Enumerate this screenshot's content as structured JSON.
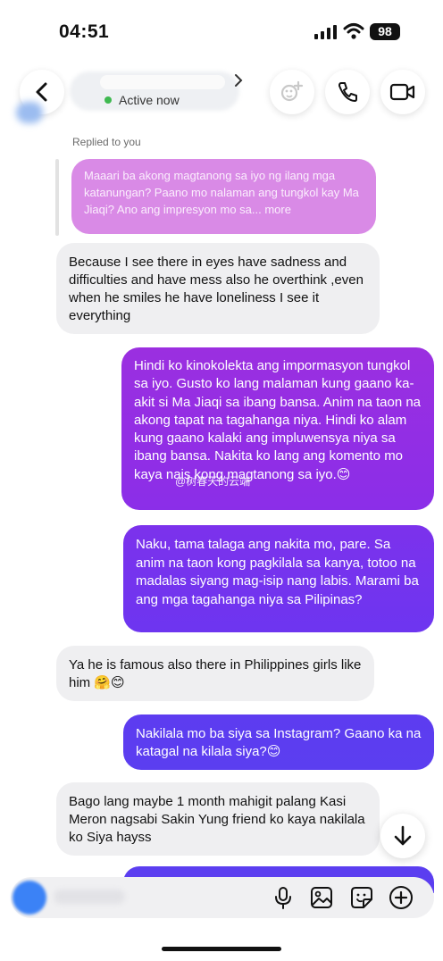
{
  "status_bar": {
    "time": "04:51",
    "battery": "98"
  },
  "header": {
    "active_status": "Active now",
    "icons": [
      "back-arrow-icon",
      "chevron-right-icon",
      "effects-icon",
      "phone-icon",
      "video-camera-icon"
    ]
  },
  "thread": {
    "reply_label": "Replied to you",
    "quoted_message": "Maaari ba akong magtanong sa iyo ng ilang mga katanungan? Paano mo nalaman ang tungkol kay Ma Jiaqi? Ano ang impresyon mo sa... more",
    "messages": [
      {
        "direction": "incoming",
        "text": "Because I see there in eyes have sadness and difficulties and have mess also he overthink ,even when he smiles he have loneliness I see it everything"
      },
      {
        "direction": "outgoing",
        "text": "Hindi ko kinokolekta ang impormasyon tungkol sa iyo. Gusto ko lang malaman kung gaano ka-akit si Ma Jiaqi sa ibang bansa. Anim na taon na akong tapat na tagahanga niya. Hindi ko alam kung gaano kalaki ang impluwensya niya sa ibang bansa. Nakita ko lang ang komento mo kaya nais kong magtanong sa iyo.😊"
      },
      {
        "direction": "outgoing",
        "text": "Naku, tama talaga ang nakita mo, pare. Sa anim na taon kong pagkilala sa kanya, totoo na madalas siyang mag-isip nang labis. Marami ba ang mga tagahanga niya sa Pilipinas?"
      },
      {
        "direction": "incoming",
        "text": "Ya he is famous also there in Philippines girls like him 🤗😊"
      },
      {
        "direction": "outgoing",
        "text": "Nakilala mo ba siya sa Instagram? Gaano ka na katagal na kilala siya?😊"
      },
      {
        "direction": "incoming",
        "text": "Bago lang maybe 1 month mahigit palang Kasi Meron nagsabi Sakin Yung friend ko kaya nakilala ko Siya hayss"
      }
    ],
    "watermark": "@树春天的云端"
  },
  "composer": {
    "icons": [
      "camera-icon",
      "microphone-icon",
      "image-icon",
      "sticker-icon",
      "plus-icon"
    ]
  },
  "colors": {
    "incoming_bubble": "#efeff1",
    "quoted_bubble": "#d98ae6",
    "outgoing_gradient_top": "#9b2fe0",
    "outgoing_gradient_bottom": "#5b3ef0"
  }
}
